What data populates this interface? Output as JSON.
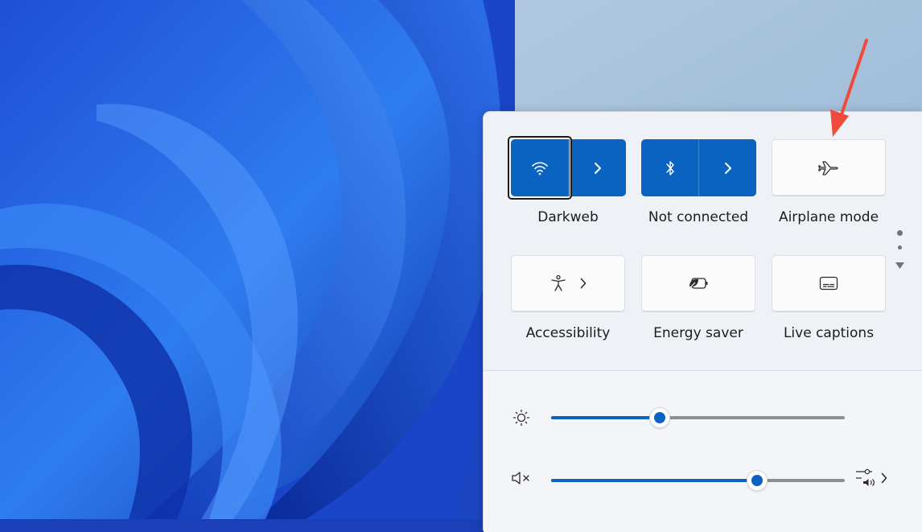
{
  "quick_settings": {
    "tiles_row1": [
      {
        "label": "Darkweb",
        "icon": "wifi-icon",
        "state": "on",
        "has_chevron": true
      },
      {
        "label": "Not connected",
        "icon": "bluetooth-icon",
        "state": "on",
        "has_chevron": true
      },
      {
        "label": "Airplane mode",
        "icon": "airplane-icon",
        "state": "off",
        "has_chevron": false
      }
    ],
    "tiles_row2": [
      {
        "label": "Accessibility",
        "icon": "accessibility-icon",
        "has_chevron": true
      },
      {
        "label": "Energy saver",
        "icon": "energy-saver-icon",
        "has_chevron": false
      },
      {
        "label": "Live captions",
        "icon": "live-captions-icon",
        "has_chevron": false
      }
    ],
    "brightness": {
      "icon": "brightness-icon",
      "value": 37
    },
    "volume": {
      "icon": "volume-muted-icon",
      "value": 70,
      "output_icon": "audio-output-icon"
    },
    "page_indicator": {
      "pages": 2,
      "current": 1
    }
  },
  "annotation": {
    "type": "arrow",
    "color": "#f04a3c",
    "points_to": "airplane-mode-tile"
  },
  "colors": {
    "accent": "#0a62c1",
    "panel": "#eef1f6",
    "tile_off": "#fbfbfc"
  }
}
